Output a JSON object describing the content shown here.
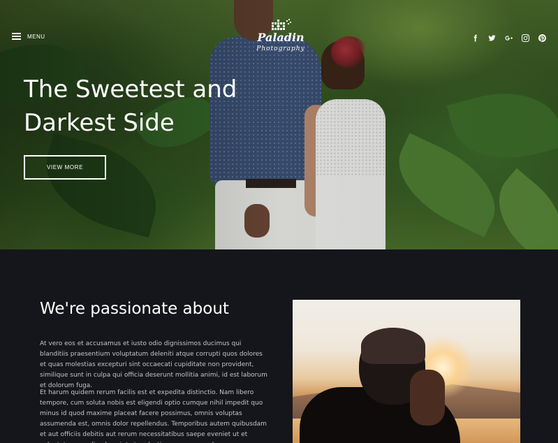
{
  "header": {
    "menu_label": "MENU",
    "logo_text": "Paladin",
    "logo_sub": "Photography",
    "social": [
      {
        "name": "facebook-icon"
      },
      {
        "name": "twitter-icon"
      },
      {
        "name": "google-plus-icon"
      },
      {
        "name": "instagram-icon"
      },
      {
        "name": "pinterest-icon"
      }
    ]
  },
  "hero": {
    "title_line1": "The Sweetest and",
    "title_line2": "Darkest Side",
    "button_label": "VIEW MORE"
  },
  "about": {
    "title": "We're passionate about",
    "paragraph1": "At vero eos et accusamus et iusto odio dignissimos ducimus qui blanditiis praesentium voluptatum deleniti atque corrupti quos dolores et quas molestias excepturi sint occaecati cupiditate non provident, similique sunt in culpa qui officia deserunt mollitia animi, id est laborum et dolorum fuga.",
    "paragraph2": "Et harum quidem rerum facilis est et expedita distinctio. Nam libero tempore, cum soluta nobis est eligendi optio cumque nihil impedit quo minus id quod maxime placeat facere possimus, omnis voluptas assumenda est, omnis dolor repellendus. Temporibus autem quibusdam et aut officiis debitis aut rerum necessitatibus saepe eveniet ut et voluptates repudiandae sint et molestiae non recusandae."
  },
  "colors": {
    "background": "#15161b",
    "text_primary": "#ffffff",
    "text_secondary": "#c4c5c9"
  }
}
